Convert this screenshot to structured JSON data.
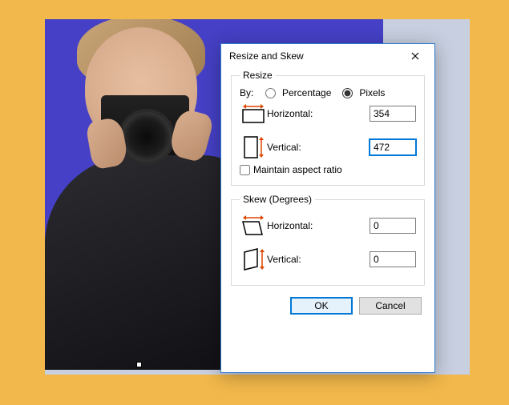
{
  "dialog": {
    "title": "Resize and Skew",
    "resize": {
      "legend": "Resize",
      "by_label": "By:",
      "percentage_label": "Percentage",
      "pixels_label": "Pixels",
      "mode_selected": "pixels",
      "horizontal_label": "Horizontal:",
      "horizontal_value": "354",
      "vertical_label": "Vertical:",
      "vertical_value": "472",
      "maintain_label": "Maintain aspect ratio",
      "maintain_checked": false
    },
    "skew": {
      "legend": "Skew (Degrees)",
      "horizontal_label": "Horizontal:",
      "horizontal_value": "0",
      "vertical_label": "Vertical:",
      "vertical_value": "0"
    },
    "ok_label": "OK",
    "cancel_label": "Cancel"
  }
}
